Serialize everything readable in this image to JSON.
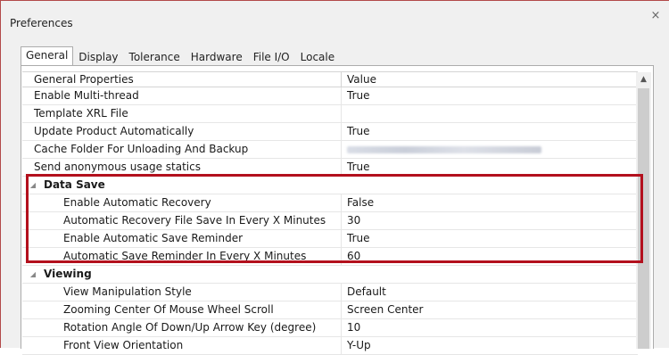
{
  "window": {
    "title": "Preferences",
    "close_glyph": "×",
    "close_icon": "close-icon"
  },
  "tabs": [
    {
      "label": "General",
      "active": true
    },
    {
      "label": "Display",
      "active": false
    },
    {
      "label": "Tolerance",
      "active": false
    },
    {
      "label": "Hardware",
      "active": false
    },
    {
      "label": "File I/O",
      "active": false
    },
    {
      "label": "Locale",
      "active": false
    }
  ],
  "grid": {
    "header_name": "General Properties",
    "header_value": "Value",
    "general_rows": [
      {
        "name": "Enable Multi-thread",
        "value": "True"
      },
      {
        "name": "Template XRL File",
        "value": ""
      },
      {
        "name": "Update Product Automatically",
        "value": "True"
      },
      {
        "name": "Cache Folder For Unloading And Backup",
        "value": ""
      },
      {
        "name": "Send anonymous usage statics",
        "value": "True"
      }
    ],
    "data_save": {
      "label": "Data Save",
      "rows": [
        {
          "name": "Enable Automatic Recovery",
          "value": "False"
        },
        {
          "name": "Automatic Recovery File Save In Every X Minutes",
          "value": "30"
        },
        {
          "name": "Enable Automatic Save Reminder",
          "value": "True"
        },
        {
          "name": "Automatic Save Reminder In Every X Minutes",
          "value": "60"
        }
      ]
    },
    "viewing": {
      "label": "Viewing",
      "rows": [
        {
          "name": "View Manipulation Style",
          "value": "Default"
        },
        {
          "name": "Zooming Center Of Mouse Wheel Scroll",
          "value": "Screen Center"
        },
        {
          "name": "Rotation Angle Of Down/Up Arrow Key (degree)",
          "value": "10"
        },
        {
          "name": "Front View Orientation",
          "value": "Y-Up"
        }
      ]
    },
    "caret_glyph": "◢",
    "scroll_up_glyph": "▲"
  },
  "colors": {
    "highlight": "#b3101d",
    "window_border": "#b24a4a"
  }
}
